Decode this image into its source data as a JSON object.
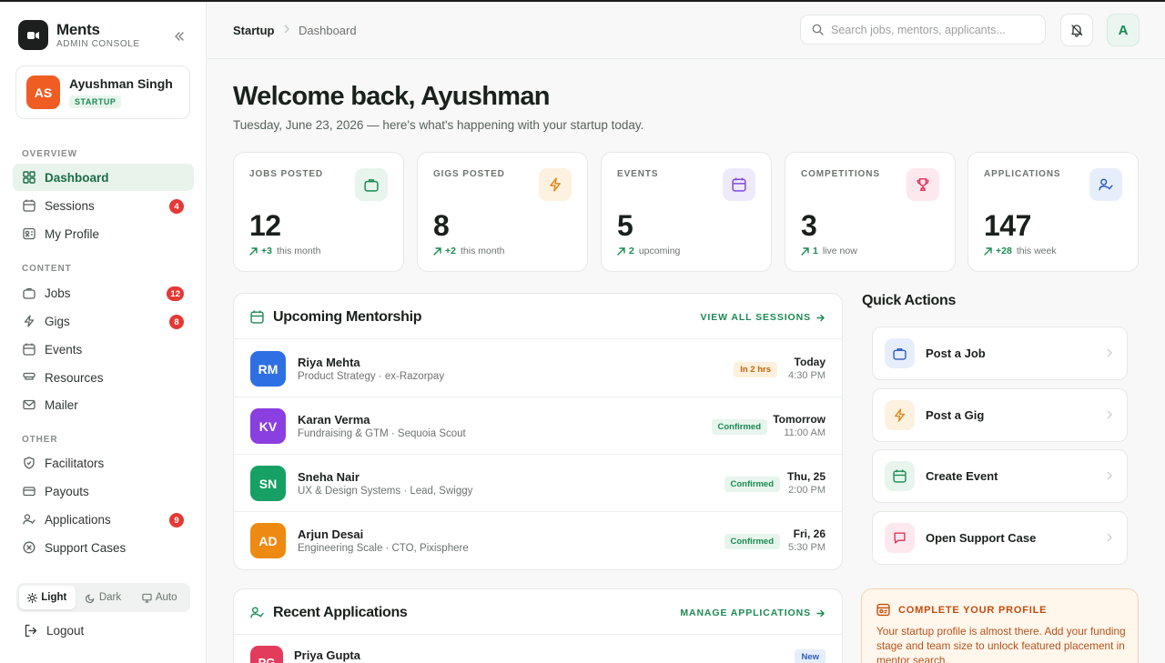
{
  "brand": {
    "name": "Ments",
    "subtitle": "ADMIN CONSOLE"
  },
  "user": {
    "initials": "AS",
    "name": "Ayushman Singh",
    "role": "STARTUP"
  },
  "sidebar": {
    "sections": {
      "overview": "OVERVIEW",
      "content": "CONTENT",
      "other": "OTHER"
    },
    "items": [
      {
        "label": "Dashboard",
        "icon": "grid-icon"
      },
      {
        "label": "Sessions",
        "icon": "calendar-icon",
        "badge": "4"
      },
      {
        "label": "My Profile",
        "icon": "id-card-icon"
      },
      {
        "label": "Jobs",
        "icon": "briefcase-icon",
        "badge": "12"
      },
      {
        "label": "Gigs",
        "icon": "bolt-icon",
        "badge": "8"
      },
      {
        "label": "Events",
        "icon": "calendar-icon"
      },
      {
        "label": "Resources",
        "icon": "book-icon"
      },
      {
        "label": "Mailer",
        "icon": "mail-icon"
      },
      {
        "label": "Facilitators",
        "icon": "shield-icon"
      },
      {
        "label": "Payouts",
        "icon": "card-icon"
      },
      {
        "label": "Applications",
        "icon": "user-check-icon",
        "badge": "9"
      },
      {
        "label": "Support Cases",
        "icon": "x-circle-icon"
      }
    ],
    "theme": {
      "light": "Light",
      "dark": "Dark",
      "auto": "Auto",
      "selected": "Light"
    },
    "logout": "Logout"
  },
  "header": {
    "breadcrumb": [
      "Startup",
      "Dashboard"
    ],
    "search_placeholder": "Search jobs, mentors, applicants...",
    "account_initial": "A"
  },
  "welcome": {
    "title": "Welcome back, Ayushman",
    "subtitle": "Tuesday, June 23, 2026 — here's what's happening with your startup today."
  },
  "stats": [
    {
      "label": "JOBS POSTED",
      "value": "12",
      "delta": "+3",
      "note": "this month",
      "icon": "briefcase-icon",
      "color": "#1a8a52",
      "bg": "#e7f5ec"
    },
    {
      "label": "GIGS POSTED",
      "value": "8",
      "delta": "+2",
      "note": "this month",
      "icon": "bolt-icon",
      "color": "#e08a1e",
      "bg": "#fdf1df"
    },
    {
      "label": "EVENTS",
      "value": "5",
      "delta": "2",
      "note": "upcoming",
      "icon": "calendar-icon",
      "color": "#7c4ddb",
      "bg": "#efe9fc"
    },
    {
      "label": "COMPETITIONS",
      "value": "3",
      "delta": "1",
      "note": "live now",
      "icon": "trophy-icon",
      "color": "#e0335a",
      "bg": "#fde8ed"
    },
    {
      "label": "APPLICATIONS",
      "value": "147",
      "delta": "+28",
      "note": "this week",
      "icon": "user-check-icon",
      "color": "#2c5dbd",
      "bg": "#e7eefb"
    }
  ],
  "mentorship": {
    "title": "Upcoming Mentorship",
    "link": "VIEW ALL SESSIONS",
    "sessions": [
      {
        "initials": "RM",
        "name": "Riya Mehta",
        "meta": "Product Strategy · ex-Razorpay",
        "status": "In 2 hrs",
        "day": "Today",
        "time": "4:30 PM",
        "color": "#2f6fe4"
      },
      {
        "initials": "KV",
        "name": "Karan Verma",
        "meta": "Fundraising & GTM · Sequoia Scout",
        "status": "Confirmed",
        "day": "Tomorrow",
        "time": "11:00 AM",
        "color": "#8a3fe0"
      },
      {
        "initials": "SN",
        "name": "Sneha Nair",
        "meta": "UX & Design Systems · Lead, Swiggy",
        "status": "Confirmed",
        "day": "Thu, 25",
        "time": "2:00 PM",
        "color": "#17a064"
      },
      {
        "initials": "AD",
        "name": "Arjun Desai",
        "meta": "Engineering Scale · CTO, Pixisphere",
        "status": "Confirmed",
        "day": "Fri, 26",
        "time": "5:30 PM",
        "color": "#ee8a12"
      }
    ]
  },
  "applications": {
    "title": "Recent Applications",
    "link": "MANAGE APPLICATIONS",
    "rows": [
      {
        "initials": "PG",
        "name": "Priya Gupta",
        "status": "New"
      }
    ]
  },
  "quick_actions": {
    "title": "Quick Actions",
    "items": [
      {
        "label": "Post a Job",
        "icon": "briefcase-icon",
        "color": "#2c5dbd",
        "bg": "#e7eefb"
      },
      {
        "label": "Post a Gig",
        "icon": "bolt-icon",
        "color": "#e08a1e",
        "bg": "#fdf1df"
      },
      {
        "label": "Create Event",
        "icon": "calendar-icon",
        "color": "#1a8a52",
        "bg": "#e7f5ec"
      },
      {
        "label": "Open Support Case",
        "icon": "message-icon",
        "color": "#e0335a",
        "bg": "#fde8ed"
      }
    ]
  },
  "profile_prompt": {
    "title": "COMPLETE YOUR PROFILE",
    "text": "Your startup profile is almost there. Add your funding stage and team size to unlock featured placement in mentor search."
  }
}
